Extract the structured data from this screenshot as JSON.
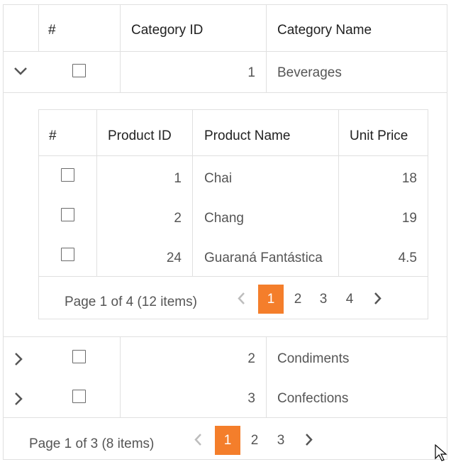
{
  "master": {
    "headers": {
      "select": "#",
      "category_id": "Category ID",
      "category_name": "Category Name"
    },
    "rows": [
      {
        "id": "1",
        "name": "Beverages",
        "expanded": true
      },
      {
        "id": "2",
        "name": "Condiments",
        "expanded": false
      },
      {
        "id": "3",
        "name": "Confections",
        "expanded": false
      }
    ],
    "pager": {
      "info": "Page 1 of 3 (8 items)",
      "pages": [
        "1",
        "2",
        "3"
      ],
      "current": "1"
    }
  },
  "detail": {
    "headers": {
      "select": "#",
      "product_id": "Product ID",
      "product_name": "Product Name",
      "unit_price": "Unit Price"
    },
    "rows": [
      {
        "id": "1",
        "name": "Chai",
        "price": "18"
      },
      {
        "id": "2",
        "name": "Chang",
        "price": "19"
      },
      {
        "id": "24",
        "name": "Guaraná Fantástica",
        "price": "4.5"
      }
    ],
    "pager": {
      "info": "Page 1 of 4 (12 items)",
      "pages": [
        "1",
        "2",
        "3",
        "4"
      ],
      "current": "1"
    }
  },
  "colors": {
    "accent": "#f47e2b",
    "border": "#e0e0e0",
    "text": "#555555",
    "header_text": "#212121"
  },
  "icons": {
    "expand_collapsed": "chevron-right-icon",
    "expand_expanded": "chevron-down-icon",
    "pager_prev": "chevron-left-icon",
    "pager_next": "chevron-right-icon"
  }
}
